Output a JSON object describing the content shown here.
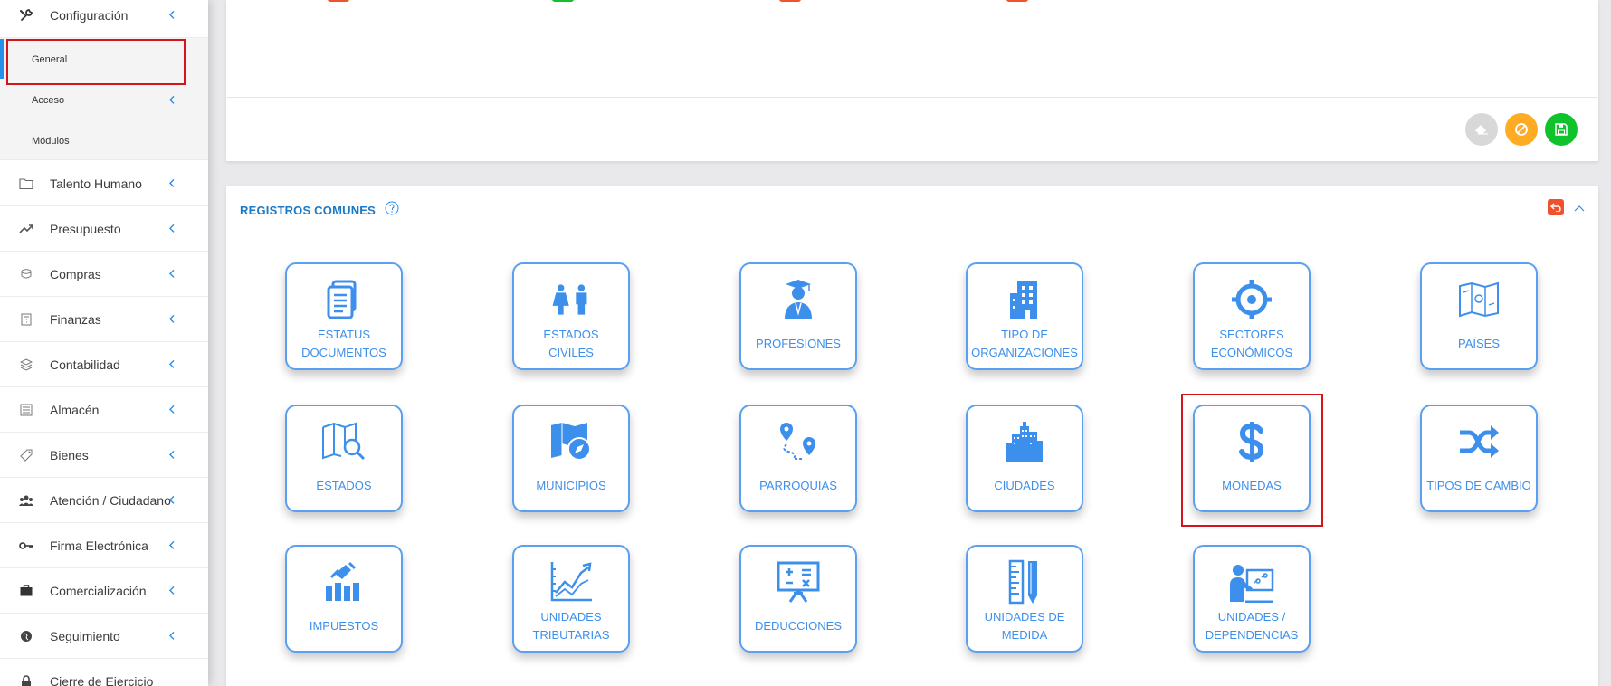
{
  "sidebar": {
    "configuracion": "Configuración",
    "sub_items": [
      "General",
      "Acceso",
      "Módulos"
    ],
    "items": [
      {
        "label": "Talento Humano",
        "icon": "folder-icon"
      },
      {
        "label": "Presupuesto",
        "icon": "trending-up-icon"
      },
      {
        "label": "Compras",
        "icon": "coins-icon"
      },
      {
        "label": "Finanzas",
        "icon": "calculator-icon"
      },
      {
        "label": "Contabilidad",
        "icon": "layers-icon"
      },
      {
        "label": "Almacén",
        "icon": "archive-icon"
      },
      {
        "label": "Bienes",
        "icon": "tag-icon"
      },
      {
        "label": "Atención / Ciudadano",
        "icon": "users-icon"
      },
      {
        "label": "Firma Electrónica",
        "icon": "key-icon"
      },
      {
        "label": "Comercialización",
        "icon": "briefcase-icon"
      },
      {
        "label": "Seguimiento",
        "icon": "globe-icon"
      },
      {
        "label": "Cierre de Ejercicio",
        "icon": "lock-icon"
      }
    ]
  },
  "top_panel": {
    "buttons": [
      "eraser-icon",
      "cancel-icon",
      "save-icon"
    ]
  },
  "registros": {
    "title": "REGISTROS COMUNES",
    "tiles": [
      {
        "label": "ESTATUS\nDOCUMENTOS",
        "icon": "document-icon"
      },
      {
        "label": "ESTADOS\nCIVILES",
        "icon": "couple-icon"
      },
      {
        "label": "PROFESIONES",
        "icon": "graduate-icon"
      },
      {
        "label": "TIPO DE\nORGANIZACIONES",
        "icon": "building-icon"
      },
      {
        "label": "SECTORES\nECONÓMICOS",
        "icon": "crosshair-icon"
      },
      {
        "label": "PAÍSES",
        "icon": "world-map-icon"
      },
      {
        "label": "ESTADOS",
        "icon": "map-search-icon"
      },
      {
        "label": "MUNICIPIOS",
        "icon": "map-compass-icon"
      },
      {
        "label": "PARROQUIAS",
        "icon": "route-pins-icon"
      },
      {
        "label": "CIUDADES",
        "icon": "city-icon"
      },
      {
        "label": "MONEDAS",
        "icon": "dollar-icon"
      },
      {
        "label": "TIPOS DE CAMBIO",
        "icon": "shuffle-icon"
      },
      {
        "label": "IMPUESTOS",
        "icon": "tax-chart-icon"
      },
      {
        "label": "UNIDADES\nTRIBUTARIAS",
        "icon": "line-chart-icon"
      },
      {
        "label": "DEDUCCIONES",
        "icon": "calculator-board-icon"
      },
      {
        "label": "UNIDADES DE\nMEDIDA",
        "icon": "ruler-pencil-icon"
      },
      {
        "label": "UNIDADES /\nDEPENDENCIAS",
        "icon": "presenter-icon"
      }
    ]
  },
  "colors": {
    "accent": "#3d8fec",
    "title_blue": "#1a7ac8",
    "highlight_red": "#d3151b",
    "save_green": "#10c22b",
    "cancel_orange": "#ffab24",
    "eraser_gray": "#d8d8d8"
  }
}
